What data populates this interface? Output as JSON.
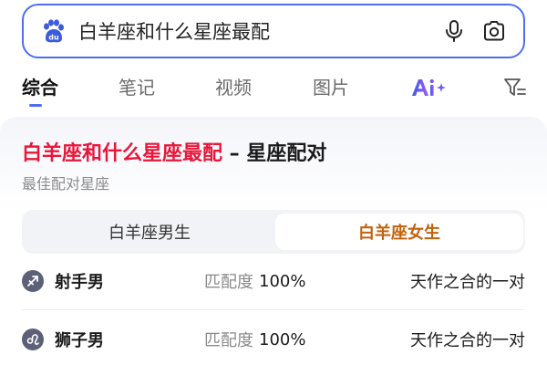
{
  "search": {
    "query": "白羊座和什么星座最配"
  },
  "tabs": [
    {
      "label": "综合"
    },
    {
      "label": "笔记"
    },
    {
      "label": "视频"
    },
    {
      "label": "图片"
    }
  ],
  "colors": {
    "accent": "#4e6ef2",
    "highlight": "#e8173a",
    "selected_segment": "#c2620e"
  },
  "result": {
    "title_highlight": "白羊座和什么星座最配",
    "title_rest": " – 星座配对",
    "subtitle": "最佳配对星座",
    "segments": [
      {
        "label": "白羊座男生"
      },
      {
        "label": "白羊座女生"
      }
    ],
    "rows": [
      {
        "icon": "sagittarius-icon",
        "name": "射手男",
        "match_label": "匹配度",
        "match_value": "100%",
        "desc": "天作之合的一对"
      },
      {
        "icon": "leo-icon",
        "name": "狮子男",
        "match_label": "匹配度",
        "match_value": "100%",
        "desc": "天作之合的一对"
      }
    ]
  }
}
